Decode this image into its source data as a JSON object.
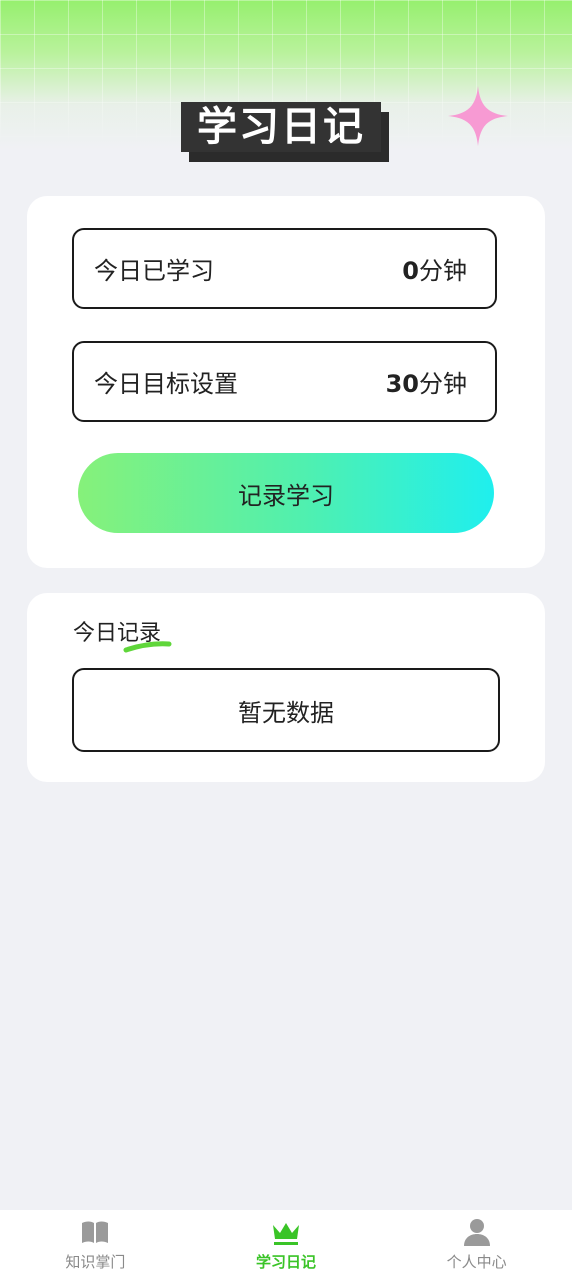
{
  "header": {
    "title": "学习日记"
  },
  "stats": {
    "today_label": "今日已学习",
    "today_value": "0",
    "today_unit": "分钟",
    "goal_label": "今日目标设置",
    "goal_value": "30",
    "goal_unit": "分钟"
  },
  "actions": {
    "record_label": "记录学习"
  },
  "today_records": {
    "title": "今日记录",
    "empty_text": "暂无数据"
  },
  "tabbar": {
    "items": [
      {
        "label": "知识掌门",
        "icon": "book-icon",
        "active": false
      },
      {
        "label": "学习日记",
        "icon": "crown-icon",
        "active": true
      },
      {
        "label": "个人中心",
        "icon": "person-icon",
        "active": false
      }
    ]
  },
  "colors": {
    "accent_green": "#3ac427",
    "button_gradient_start": "#86f17a",
    "button_gradient_end": "#1fefee",
    "sparkle_pink": "#f79ad3",
    "background": "#f0f1f5"
  }
}
